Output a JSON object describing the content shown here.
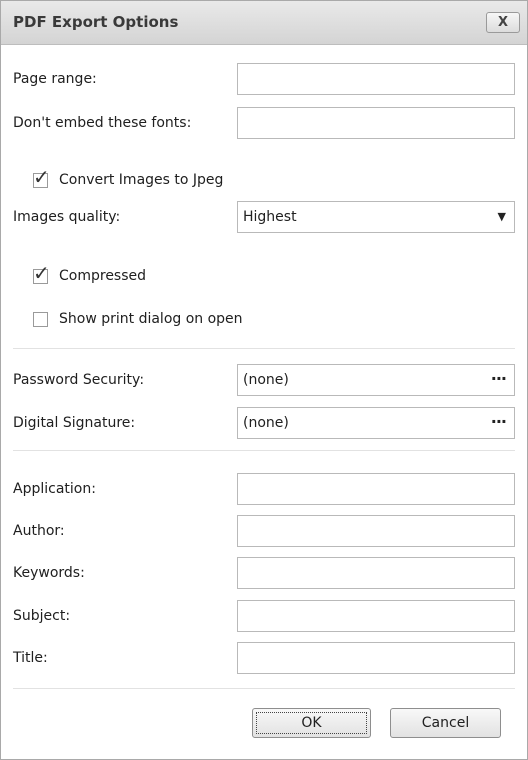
{
  "dialog": {
    "title": "PDF Export Options",
    "close_label": "X"
  },
  "fields": {
    "page_range_label": "Page range:",
    "page_range_value": "",
    "dont_embed_fonts_label": "Don't embed these fonts:",
    "dont_embed_fonts_value": "",
    "convert_images_label": "Convert Images to Jpeg",
    "convert_images_checked": true,
    "images_quality_label": "Images quality:",
    "images_quality_value": "Highest",
    "compressed_label": "Compressed",
    "compressed_checked": true,
    "show_print_dialog_label": "Show print dialog on open",
    "show_print_dialog_checked": false,
    "password_security_label": "Password Security:",
    "password_security_value": "(none)",
    "digital_signature_label": "Digital Signature:",
    "digital_signature_value": "(none)",
    "ellipsis_glyph": "···",
    "application_label": "Application:",
    "application_value": "",
    "author_label": "Author:",
    "author_value": "",
    "keywords_label": "Keywords:",
    "keywords_value": "",
    "subject_label": "Subject:",
    "subject_value": "",
    "title_label": "Title:",
    "title_value": ""
  },
  "buttons": {
    "ok_label": "OK",
    "cancel_label": "Cancel"
  },
  "icons": {
    "close": "close-icon",
    "dropdown": "chevron-down-icon",
    "ellipsis": "ellipsis-icon",
    "checkmark": "checkmark-icon"
  },
  "colors": {
    "titlebar": "#dcdcdc",
    "border": "#a9a9a9",
    "field_border": "#b9b9b9"
  }
}
